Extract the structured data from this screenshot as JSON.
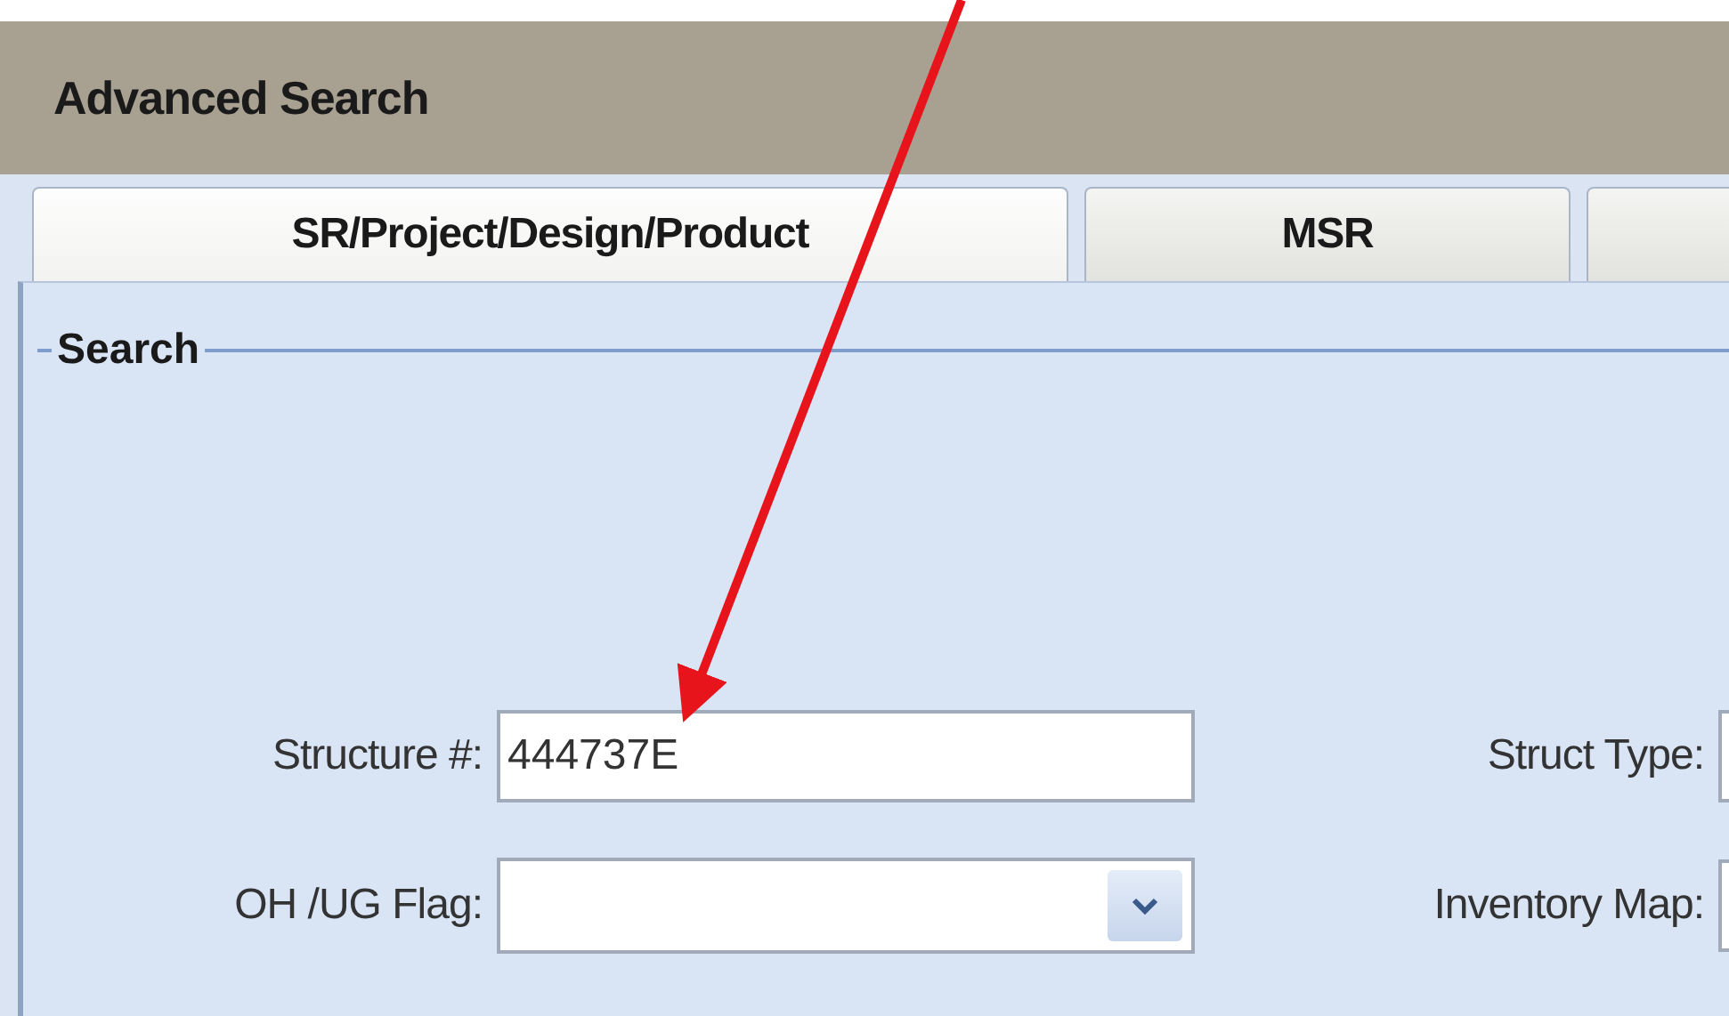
{
  "window": {
    "title": "Advanced Search"
  },
  "tabs": [
    {
      "label": "SR/Project/Design/Product",
      "selected": true
    },
    {
      "label": "MSR",
      "selected": false
    },
    {
      "selected": false
    }
  ],
  "search_group": {
    "title": "Search",
    "fields": [
      {
        "kind": "text",
        "label": "Structure #:",
        "value": "444737E"
      },
      {
        "kind": "text",
        "label": "Struct Type:"
      },
      {
        "kind": "dropdown",
        "label": "OH /UG Flag:"
      },
      {
        "kind": "text",
        "label": "Inventory Map:"
      }
    ]
  }
}
